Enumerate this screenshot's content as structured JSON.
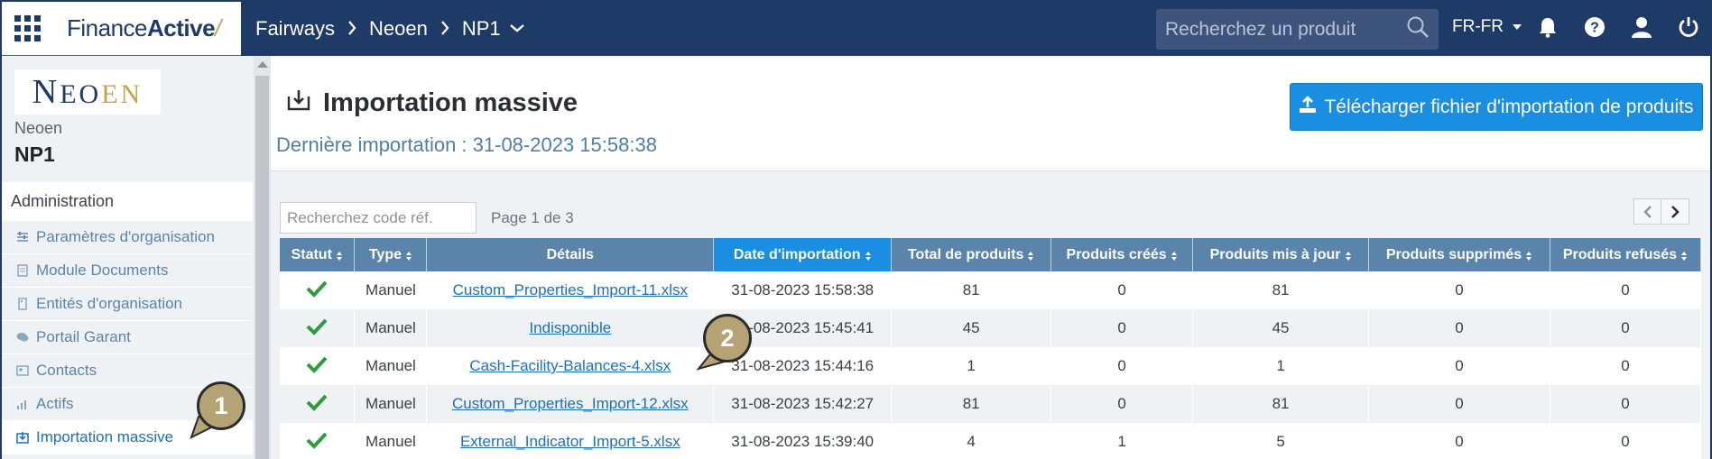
{
  "topbar": {
    "brand_part1": "Finance",
    "brand_part2": "Active",
    "brand_slash": "/",
    "breadcrumb": [
      "Fairways",
      "Neoen",
      "NP1"
    ],
    "search_placeholder": "Recherchez un produit",
    "language": "FR-FR",
    "icons": [
      "apps-grid-icon",
      "chevron-down-icon",
      "search-icon",
      "bell-icon",
      "help-icon",
      "user-icon",
      "power-icon"
    ]
  },
  "sidebar": {
    "company_logo_text": "NEOEN",
    "client_name": "Neoen",
    "project_name": "NP1",
    "section_title": "Administration",
    "items": [
      {
        "label": "Paramètres d'organisation",
        "icon": "sliders-icon"
      },
      {
        "label": "Module Documents",
        "icon": "document-icon"
      },
      {
        "label": "Entités d'organisation",
        "icon": "building-icon"
      },
      {
        "label": "Portail Garant",
        "icon": "chat-icon"
      },
      {
        "label": "Contacts",
        "icon": "contact-card-icon"
      },
      {
        "label": "Actifs",
        "icon": "bar-chart-icon"
      },
      {
        "label": "Importation massive",
        "icon": "import-icon",
        "active": true
      }
    ]
  },
  "main": {
    "title": "Importation massive",
    "last_import": "Dernière importation : 31-08-2023 15:58:38",
    "upload_button": "Télécharger fichier d'importation de produits",
    "code_search_placeholder": "Recherchez code réf.",
    "page_info": "Page 1 de 3",
    "table": {
      "columns": [
        "Statut",
        "Type",
        "Détails",
        "Date d'importation",
        "Total de produits",
        "Produits créés",
        "Produits mis à jour",
        "Produits supprimés",
        "Produits refusés"
      ],
      "sorted_column": "Date d'importation",
      "rows": [
        {
          "status": "success",
          "type": "Manuel",
          "details": "Custom_Properties_Import-11.xlsx",
          "date": "31-08-2023 15:58:38",
          "total": "81",
          "created": "0",
          "updated": "81",
          "deleted": "0",
          "refused": "0"
        },
        {
          "status": "success",
          "type": "Manuel",
          "details": "Indisponible",
          "date": "31-08-2023 15:45:41",
          "total": "45",
          "created": "0",
          "updated": "45",
          "deleted": "0",
          "refused": "0"
        },
        {
          "status": "success",
          "type": "Manuel",
          "details": "Cash-Facility-Balances-4.xlsx",
          "date": "31-08-2023 15:44:16",
          "total": "1",
          "created": "0",
          "updated": "1",
          "deleted": "0",
          "refused": "0"
        },
        {
          "status": "success",
          "type": "Manuel",
          "details": "Custom_Properties_Import-12.xlsx",
          "date": "31-08-2023 15:42:27",
          "total": "81",
          "created": "0",
          "updated": "81",
          "deleted": "0",
          "refused": "0"
        },
        {
          "status": "success",
          "type": "Manuel",
          "details": "External_Indicator_Import-5.xlsx",
          "date": "31-08-2023 15:39:40",
          "total": "4",
          "created": "1",
          "updated": "5",
          "deleted": "0",
          "refused": "0"
        }
      ]
    }
  },
  "callouts": [
    "1",
    "2"
  ],
  "colors": {
    "topbar": "#1e3a66",
    "accent": "#1a8ee0",
    "table_header": "#5a84a9",
    "success": "#2e9c3b",
    "callout": "#b5a375"
  }
}
